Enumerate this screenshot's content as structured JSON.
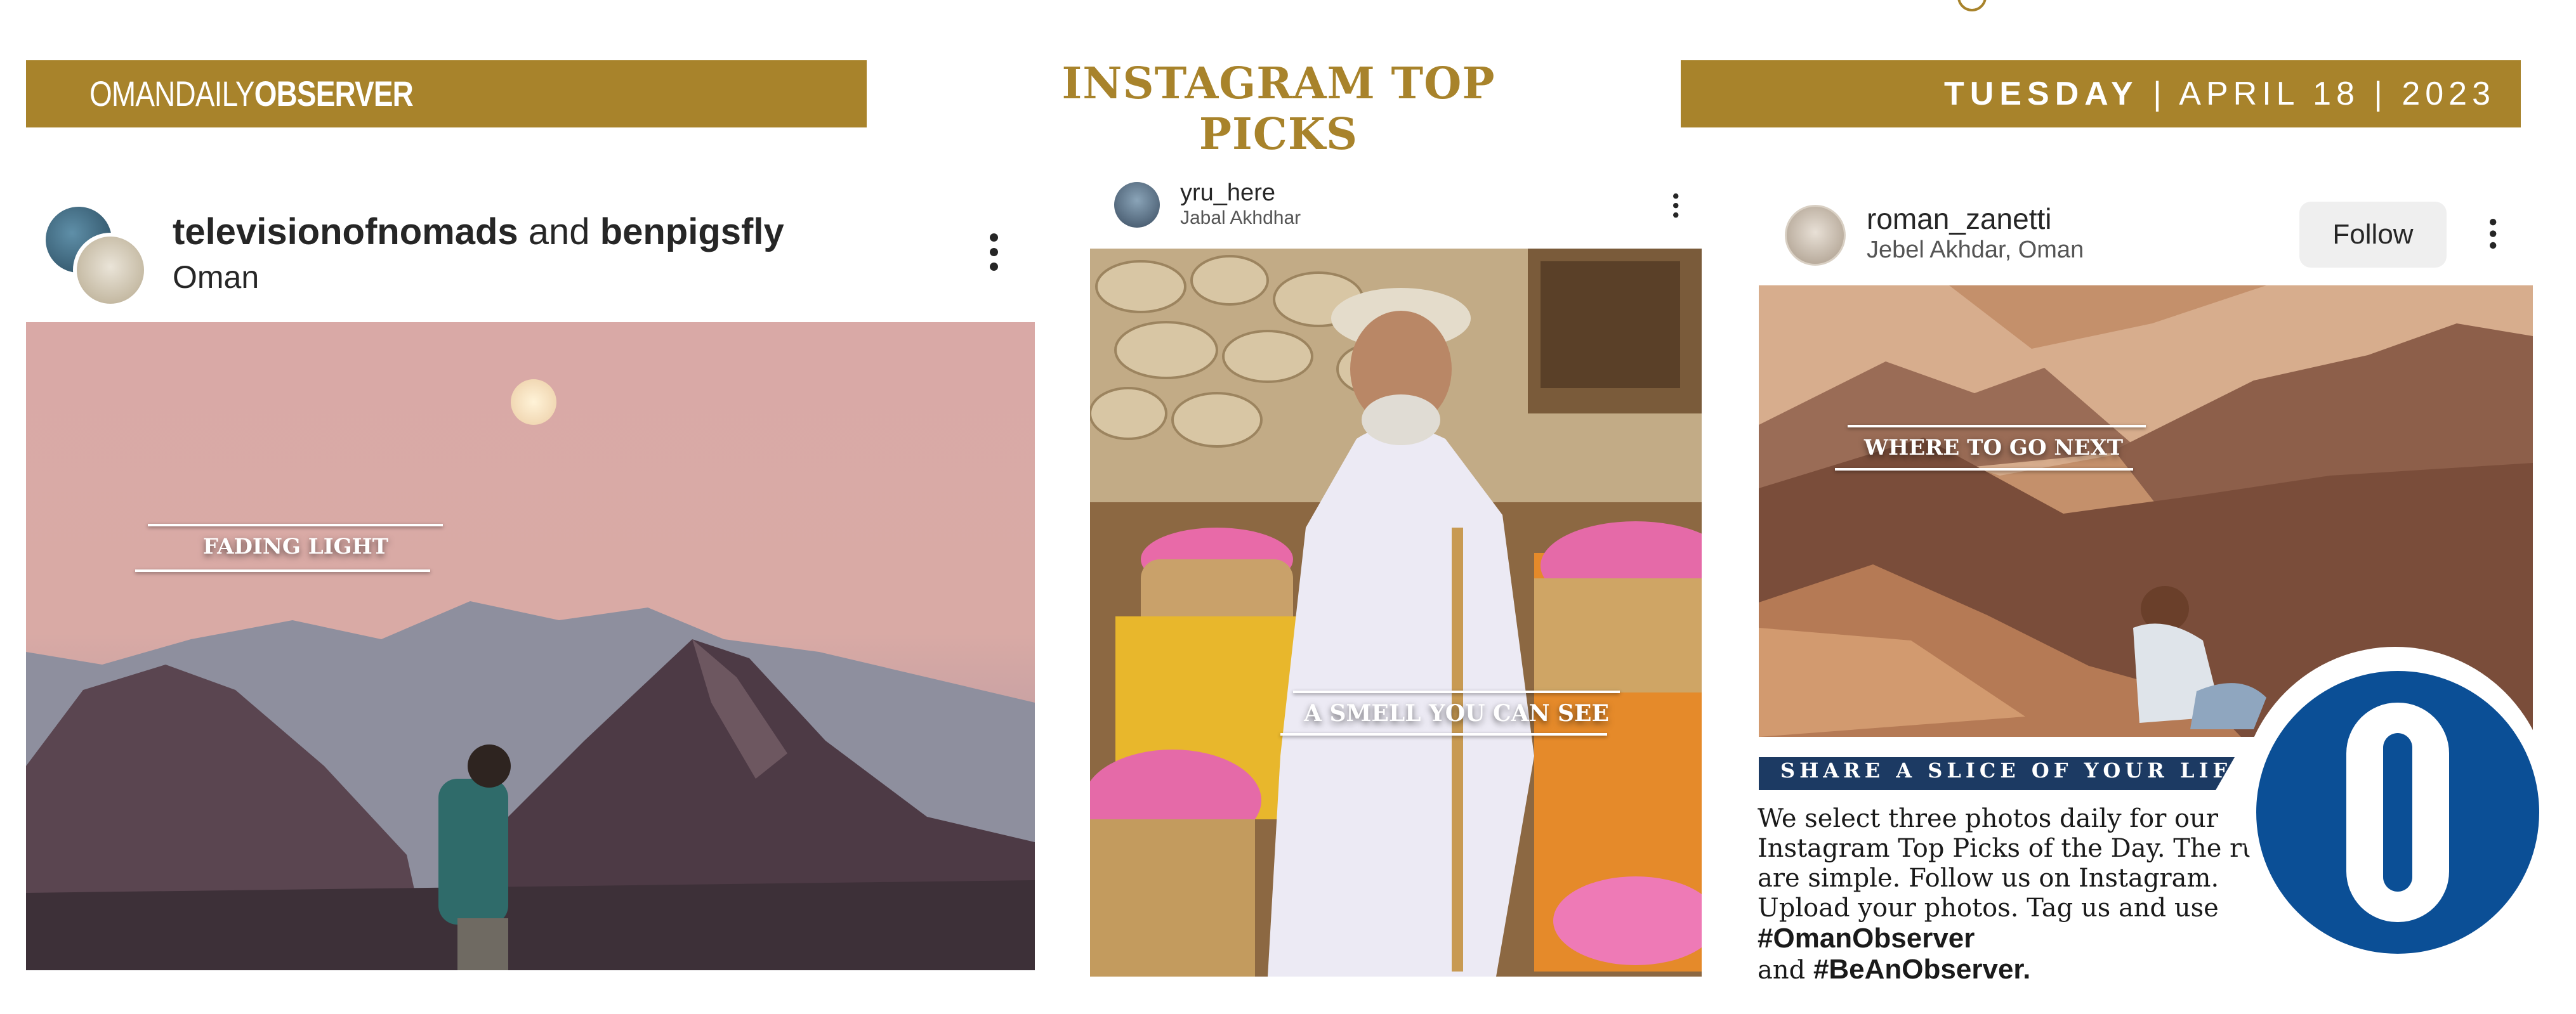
{
  "header": {
    "logo_light": "OMANDAILY",
    "logo_bold": "OBSERVER",
    "title": "INSTAGRAM TOP PICKS",
    "day": "TUESDAY",
    "date": "| APRIL 18 | 2023"
  },
  "posts": [
    {
      "user_a": "televisionofnomads",
      "joiner": "and",
      "user_b": "benpigsfly",
      "location": "Oman",
      "caption": "FADING LIGHT"
    },
    {
      "user": "yru_here",
      "location": "Jabal Akhdhar",
      "caption": "A SMELL YOU CAN SEE"
    },
    {
      "user": "roman_zanetti",
      "location": "Jebel Akhdar, Oman",
      "follow_label": "Follow",
      "caption": "WHERE TO GO NEXT"
    }
  ],
  "share": {
    "heading": "SHARE A SLICE OF YOUR LIFE",
    "body": "We select three photos daily for our Instagram Top Picks of the Day. The rules are simple. Follow us on Instagram. Upload your photos. Tag us and use",
    "hashtag1": "#OmanObserver",
    "and": "and",
    "hashtag2": "#BeAnObserver."
  },
  "colors": {
    "brand_gold": "#a8832b",
    "share_navy": "#1c3a63",
    "seal_blue": "#0b4f96"
  },
  "icons": {
    "more": "more-vertical-icon",
    "seal": "observer-seal-logo"
  }
}
